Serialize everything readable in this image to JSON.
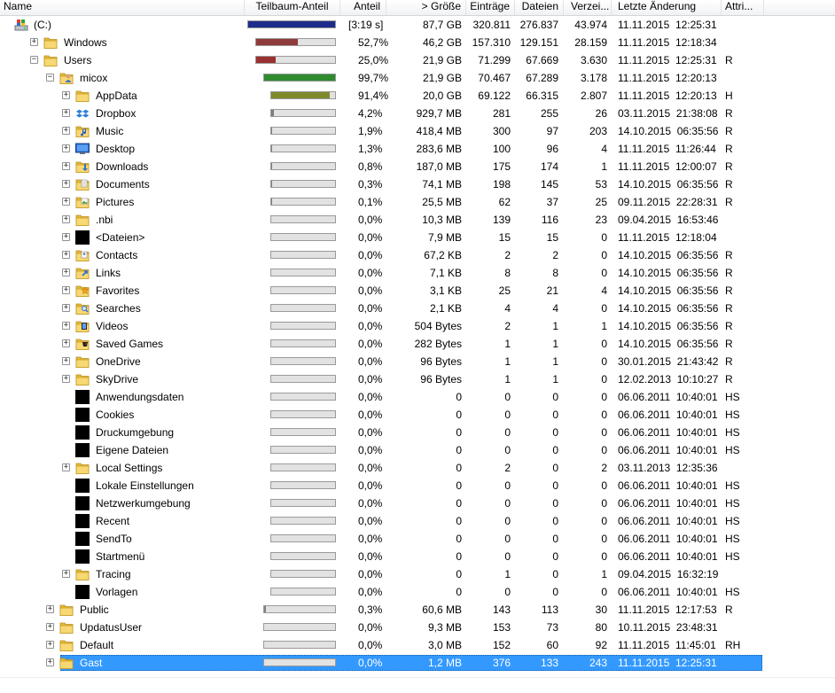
{
  "columns": [
    "Name",
    "Teilbaum-Anteil",
    "Anteil",
    "> Größe",
    "Einträge",
    "Dateien",
    "Verzei...",
    "Letzte Änderung",
    "Attri..."
  ],
  "colors": {
    "bar_root": "#1f2b8a",
    "bar_windows": "#8f3b3b",
    "bar_users": "#9b3030",
    "bar_micox": "#2e8b2e",
    "bar_appdata": "#7f8a2a",
    "bar_track": "#e2e2e2",
    "selection": "#3399ff"
  },
  "rows": [
    {
      "name": "(C:)",
      "depth": 0,
      "icon": "drive-icon",
      "expander": "none",
      "share": 1.0,
      "bar": "root",
      "anteil": "[3:19 s]",
      "size": "87,7 GB",
      "entries": "320.811",
      "files": "276.837",
      "dirs": "43.974",
      "modified": "11.11.2015  12:25:31",
      "attr": ""
    },
    {
      "name": "Windows",
      "depth": 1,
      "icon": "folder-icon",
      "expander": "plus",
      "share": 0.527,
      "bar": "windows",
      "anteil": "52,7%",
      "size": "46,2 GB",
      "entries": "157.310",
      "files": "129.151",
      "dirs": "28.159",
      "modified": "11.11.2015  12:18:34",
      "attr": ""
    },
    {
      "name": "Users",
      "depth": 1,
      "icon": "folder-icon",
      "expander": "minus",
      "share": 0.25,
      "bar": "users",
      "anteil": "25,0%",
      "size": "21,9 GB",
      "entries": "71.299",
      "files": "67.669",
      "dirs": "3.630",
      "modified": "11.11.2015  12:25:31",
      "attr": "R"
    },
    {
      "name": "micox",
      "depth": 2,
      "icon": "user-folder-icon",
      "expander": "minus",
      "share": 0.997,
      "bar": "micox",
      "anteil": "99,7%",
      "size": "21,9 GB",
      "entries": "70.467",
      "files": "67.289",
      "dirs": "3.178",
      "modified": "11.11.2015  12:20:13",
      "attr": ""
    },
    {
      "name": "AppData",
      "depth": 3,
      "icon": "folder-icon",
      "expander": "plus",
      "share": 0.914,
      "bar": "appdata",
      "anteil": "91,4%",
      "size": "20,0 GB",
      "entries": "69.122",
      "files": "66.315",
      "dirs": "2.807",
      "modified": "11.11.2015  12:20:13",
      "attr": "H"
    },
    {
      "name": "Dropbox",
      "depth": 3,
      "icon": "dropbox-folder-icon",
      "expander": "plus",
      "share": 0.042,
      "bar": "small",
      "anteil": "4,2%",
      "size": "929,7 MB",
      "entries": "281",
      "files": "255",
      "dirs": "26",
      "modified": "03.11.2015  21:38:08",
      "attr": "R"
    },
    {
      "name": "Music",
      "depth": 3,
      "icon": "music-folder-icon",
      "expander": "plus",
      "share": 0.019,
      "bar": "small",
      "anteil": "1,9%",
      "size": "418,4 MB",
      "entries": "300",
      "files": "97",
      "dirs": "203",
      "modified": "14.10.2015  06:35:56",
      "attr": "R"
    },
    {
      "name": "Desktop",
      "depth": 3,
      "icon": "desktop-folder-icon",
      "expander": "plus",
      "share": 0.013,
      "bar": "small",
      "anteil": "1,3%",
      "size": "283,6 MB",
      "entries": "100",
      "files": "96",
      "dirs": "4",
      "modified": "11.11.2015  11:26:44",
      "attr": "R"
    },
    {
      "name": "Downloads",
      "depth": 3,
      "icon": "downloads-folder-icon",
      "expander": "plus",
      "share": 0.008,
      "bar": "small",
      "anteil": "0,8%",
      "size": "187,0 MB",
      "entries": "175",
      "files": "174",
      "dirs": "1",
      "modified": "11.11.2015  12:00:07",
      "attr": "R"
    },
    {
      "name": "Documents",
      "depth": 3,
      "icon": "documents-folder-icon",
      "expander": "plus",
      "share": 0.003,
      "bar": "small",
      "anteil": "0,3%",
      "size": "74,1 MB",
      "entries": "198",
      "files": "145",
      "dirs": "53",
      "modified": "14.10.2015  06:35:56",
      "attr": "R"
    },
    {
      "name": "Pictures",
      "depth": 3,
      "icon": "pictures-folder-icon",
      "expander": "plus",
      "share": 0.001,
      "bar": "small",
      "anteil": "0,1%",
      "size": "25,5 MB",
      "entries": "62",
      "files": "37",
      "dirs": "25",
      "modified": "09.11.2015  22:28:31",
      "attr": "R"
    },
    {
      "name": ".nbi",
      "depth": 3,
      "icon": "folder-icon",
      "expander": "plus",
      "share": 0,
      "bar": "small",
      "anteil": "0,0%",
      "size": "10,3 MB",
      "entries": "139",
      "files": "116",
      "dirs": "23",
      "modified": "09.04.2015  16:53:46",
      "attr": ""
    },
    {
      "name": "<Dateien>",
      "depth": 3,
      "icon": "files-block-icon",
      "expander": "plus",
      "share": 0,
      "bar": "small",
      "anteil": "0,0%",
      "size": "7,9 MB",
      "entries": "15",
      "files": "15",
      "dirs": "0",
      "modified": "11.11.2015  12:18:04",
      "attr": ""
    },
    {
      "name": "Contacts",
      "depth": 3,
      "icon": "contacts-folder-icon",
      "expander": "plus",
      "share": 0,
      "bar": "small",
      "anteil": "0,0%",
      "size": "67,2 KB",
      "entries": "2",
      "files": "2",
      "dirs": "0",
      "modified": "14.10.2015  06:35:56",
      "attr": "R"
    },
    {
      "name": "Links",
      "depth": 3,
      "icon": "links-folder-icon",
      "expander": "plus",
      "share": 0,
      "bar": "small",
      "anteil": "0,0%",
      "size": "7,1 KB",
      "entries": "8",
      "files": "8",
      "dirs": "0",
      "modified": "14.10.2015  06:35:56",
      "attr": "R"
    },
    {
      "name": "Favorites",
      "depth": 3,
      "icon": "favorites-folder-icon",
      "expander": "plus",
      "share": 0,
      "bar": "small",
      "anteil": "0,0%",
      "size": "3,1 KB",
      "entries": "25",
      "files": "21",
      "dirs": "4",
      "modified": "14.10.2015  06:35:56",
      "attr": "R"
    },
    {
      "name": "Searches",
      "depth": 3,
      "icon": "searches-folder-icon",
      "expander": "plus",
      "share": 0,
      "bar": "small",
      "anteil": "0,0%",
      "size": "2,1 KB",
      "entries": "4",
      "files": "4",
      "dirs": "0",
      "modified": "14.10.2015  06:35:56",
      "attr": "R"
    },
    {
      "name": "Videos",
      "depth": 3,
      "icon": "videos-folder-icon",
      "expander": "plus",
      "share": 0,
      "bar": "small",
      "anteil": "0,0%",
      "size": "504 Bytes",
      "entries": "2",
      "files": "1",
      "dirs": "1",
      "modified": "14.10.2015  06:35:56",
      "attr": "R"
    },
    {
      "name": "Saved Games",
      "depth": 3,
      "icon": "saved-games-folder-icon",
      "expander": "plus",
      "share": 0,
      "bar": "small",
      "anteil": "0,0%",
      "size": "282 Bytes",
      "entries": "1",
      "files": "1",
      "dirs": "0",
      "modified": "14.10.2015  06:35:56",
      "attr": "R"
    },
    {
      "name": "OneDrive",
      "depth": 3,
      "icon": "folder-icon",
      "expander": "plus",
      "share": 0,
      "bar": "small",
      "anteil": "0,0%",
      "size": "96 Bytes",
      "entries": "1",
      "files": "1",
      "dirs": "0",
      "modified": "30.01.2015  21:43:42",
      "attr": "R"
    },
    {
      "name": "SkyDrive",
      "depth": 3,
      "icon": "folder-icon",
      "expander": "plus",
      "share": 0,
      "bar": "small",
      "anteil": "0,0%",
      "size": "96 Bytes",
      "entries": "1",
      "files": "1",
      "dirs": "0",
      "modified": "12.02.2013  10:10:27",
      "attr": "R"
    },
    {
      "name": "Anwendungsdaten",
      "depth": 3,
      "icon": "junction-icon",
      "expander": "none",
      "share": 0,
      "bar": "small",
      "anteil": "0,0%",
      "size": "0",
      "entries": "0",
      "files": "0",
      "dirs": "0",
      "modified": "06.06.2011  10:40:01",
      "attr": "HS"
    },
    {
      "name": "Cookies",
      "depth": 3,
      "icon": "junction-icon",
      "expander": "none",
      "share": 0,
      "bar": "small",
      "anteil": "0,0%",
      "size": "0",
      "entries": "0",
      "files": "0",
      "dirs": "0",
      "modified": "06.06.2011  10:40:01",
      "attr": "HS"
    },
    {
      "name": "Druckumgebung",
      "depth": 3,
      "icon": "junction-icon",
      "expander": "none",
      "share": 0,
      "bar": "small",
      "anteil": "0,0%",
      "size": "0",
      "entries": "0",
      "files": "0",
      "dirs": "0",
      "modified": "06.06.2011  10:40:01",
      "attr": "HS"
    },
    {
      "name": "Eigene Dateien",
      "depth": 3,
      "icon": "junction-icon",
      "expander": "none",
      "share": 0,
      "bar": "small",
      "anteil": "0,0%",
      "size": "0",
      "entries": "0",
      "files": "0",
      "dirs": "0",
      "modified": "06.06.2011  10:40:01",
      "attr": "HS"
    },
    {
      "name": "Local Settings",
      "depth": 3,
      "icon": "folder-icon",
      "expander": "plus",
      "share": 0,
      "bar": "small",
      "anteil": "0,0%",
      "size": "0",
      "entries": "2",
      "files": "0",
      "dirs": "2",
      "modified": "03.11.2013  12:35:36",
      "attr": ""
    },
    {
      "name": "Lokale Einstellungen",
      "depth": 3,
      "icon": "junction-icon",
      "expander": "none",
      "share": 0,
      "bar": "small",
      "anteil": "0,0%",
      "size": "0",
      "entries": "0",
      "files": "0",
      "dirs": "0",
      "modified": "06.06.2011  10:40:01",
      "attr": "HS"
    },
    {
      "name": "Netzwerkumgebung",
      "depth": 3,
      "icon": "junction-icon",
      "expander": "none",
      "share": 0,
      "bar": "small",
      "anteil": "0,0%",
      "size": "0",
      "entries": "0",
      "files": "0",
      "dirs": "0",
      "modified": "06.06.2011  10:40:01",
      "attr": "HS"
    },
    {
      "name": "Recent",
      "depth": 3,
      "icon": "junction-icon",
      "expander": "none",
      "share": 0,
      "bar": "small",
      "anteil": "0,0%",
      "size": "0",
      "entries": "0",
      "files": "0",
      "dirs": "0",
      "modified": "06.06.2011  10:40:01",
      "attr": "HS"
    },
    {
      "name": "SendTo",
      "depth": 3,
      "icon": "junction-icon",
      "expander": "none",
      "share": 0,
      "bar": "small",
      "anteil": "0,0%",
      "size": "0",
      "entries": "0",
      "files": "0",
      "dirs": "0",
      "modified": "06.06.2011  10:40:01",
      "attr": "HS"
    },
    {
      "name": "Startmenü",
      "depth": 3,
      "icon": "junction-icon",
      "expander": "none",
      "share": 0,
      "bar": "small",
      "anteil": "0,0%",
      "size": "0",
      "entries": "0",
      "files": "0",
      "dirs": "0",
      "modified": "06.06.2011  10:40:01",
      "attr": "HS"
    },
    {
      "name": "Tracing",
      "depth": 3,
      "icon": "folder-icon",
      "expander": "plus",
      "share": 0,
      "bar": "small",
      "anteil": "0,0%",
      "size": "0",
      "entries": "1",
      "files": "0",
      "dirs": "1",
      "modified": "09.04.2015  16:32:19",
      "attr": ""
    },
    {
      "name": "Vorlagen",
      "depth": 3,
      "icon": "junction-icon",
      "expander": "none",
      "share": 0,
      "bar": "small",
      "anteil": "0,0%",
      "size": "0",
      "entries": "0",
      "files": "0",
      "dirs": "0",
      "modified": "06.06.2011  10:40:01",
      "attr": "HS"
    },
    {
      "name": "Public",
      "depth": 2,
      "icon": "folder-icon",
      "expander": "plus",
      "share": 0.003,
      "bar": "small",
      "anteil": "0,3%",
      "size": "60,6 MB",
      "entries": "143",
      "files": "113",
      "dirs": "30",
      "modified": "11.11.2015  12:17:53",
      "attr": "R"
    },
    {
      "name": "UpdatusUser",
      "depth": 2,
      "icon": "folder-icon",
      "expander": "plus",
      "share": 0,
      "bar": "small",
      "anteil": "0,0%",
      "size": "9,3 MB",
      "entries": "153",
      "files": "73",
      "dirs": "80",
      "modified": "10.11.2015  23:48:31",
      "attr": ""
    },
    {
      "name": "Default",
      "depth": 2,
      "icon": "folder-icon",
      "expander": "plus",
      "share": 0,
      "bar": "small",
      "anteil": "0,0%",
      "size": "3,0 MB",
      "entries": "152",
      "files": "60",
      "dirs": "92",
      "modified": "11.11.2015  11:45:01",
      "attr": "RH"
    },
    {
      "name": "Gast",
      "depth": 2,
      "icon": "folder-icon",
      "expander": "plus",
      "share": 0,
      "bar": "small",
      "anteil": "0,0%",
      "size": "1,2 MB",
      "entries": "376",
      "files": "133",
      "dirs": "243",
      "modified": "11.11.2015  12:25:31",
      "attr": "",
      "selected": true
    }
  ]
}
